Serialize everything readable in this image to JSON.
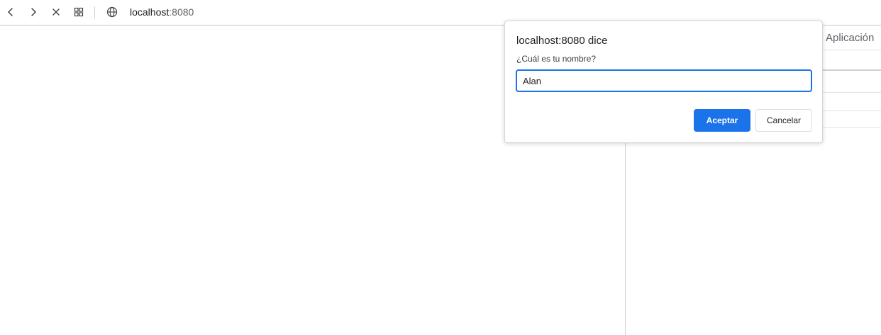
{
  "toolbar": {
    "back_icon": "chevron-left-icon",
    "forward_icon": "chevron-right-icon",
    "stop_icon": "close-icon",
    "tabs_icon": "grid-icon",
    "site_icon": "globe-icon",
    "url_host": "localhost",
    "url_port": ":8080"
  },
  "devtools": {
    "tab_label": "Aplicación"
  },
  "dialog": {
    "title": "localhost:8080 dice",
    "message": "¿Cuál es tu nombre?",
    "input_value": "Alan",
    "ok_label": "Aceptar",
    "cancel_label": "Cancelar",
    "accent_color": "#1a73e8"
  }
}
